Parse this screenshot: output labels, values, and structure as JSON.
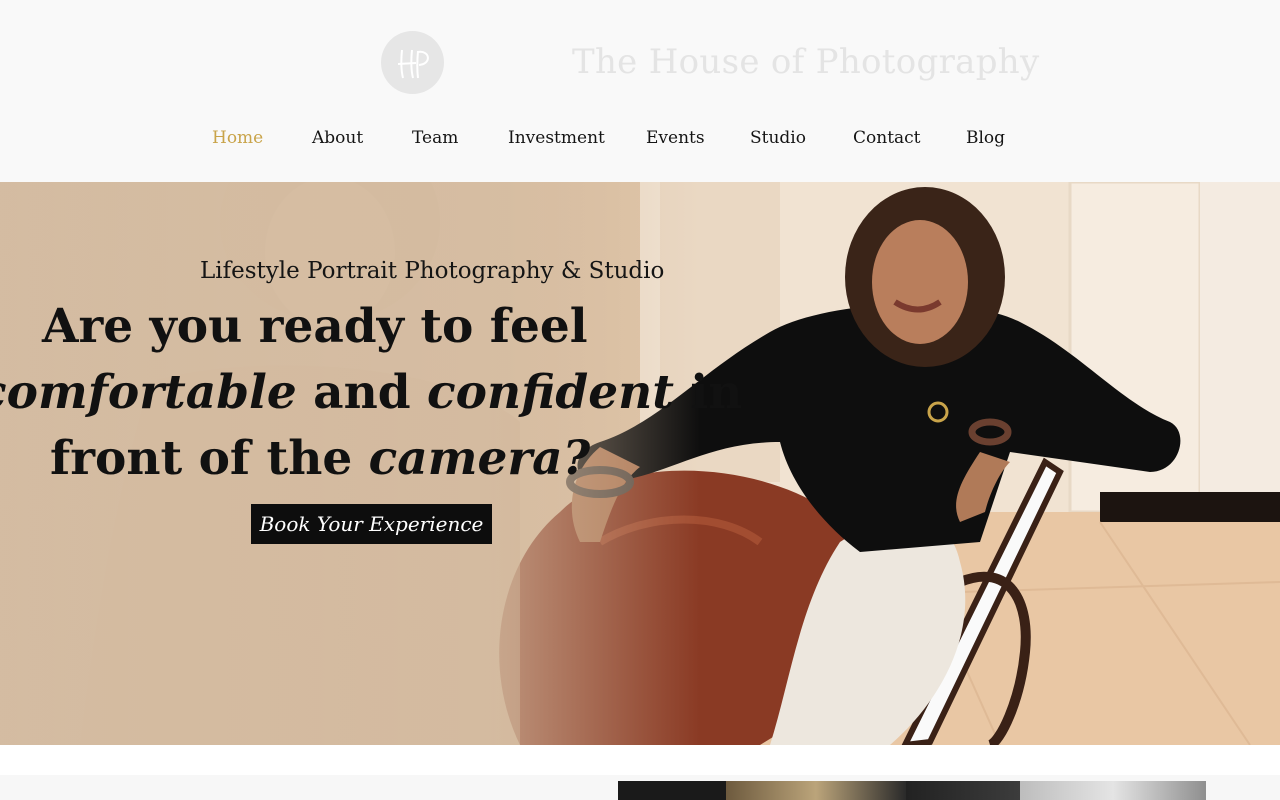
{
  "header": {
    "logo_text": "HP",
    "site_title": "The House of Photography"
  },
  "nav": {
    "items": [
      {
        "label": "Home",
        "active": true
      },
      {
        "label": "About",
        "active": false
      },
      {
        "label": "Team",
        "active": false
      },
      {
        "label": "Investment",
        "active": false
      },
      {
        "label": "Events",
        "active": false
      },
      {
        "label": "Studio",
        "active": false
      },
      {
        "label": "Contact",
        "active": false
      },
      {
        "label": "Blog",
        "active": false
      }
    ]
  },
  "hero": {
    "subtitle": "Lifestyle Portrait Photography & Studio",
    "headline": {
      "line1": "Are you ready to feel",
      "line2_em1": "comfortable",
      "line2_mid": " and ",
      "line2_em2": "confident",
      "line2_end": " in",
      "line3_start": "front of the ",
      "line3_em": "camera?"
    },
    "cta_label": "Book Your Experience"
  },
  "colors": {
    "accent": "#c9a44a",
    "cta_bg": "#0d0d0d",
    "header_bg": "#f9f9f9"
  }
}
